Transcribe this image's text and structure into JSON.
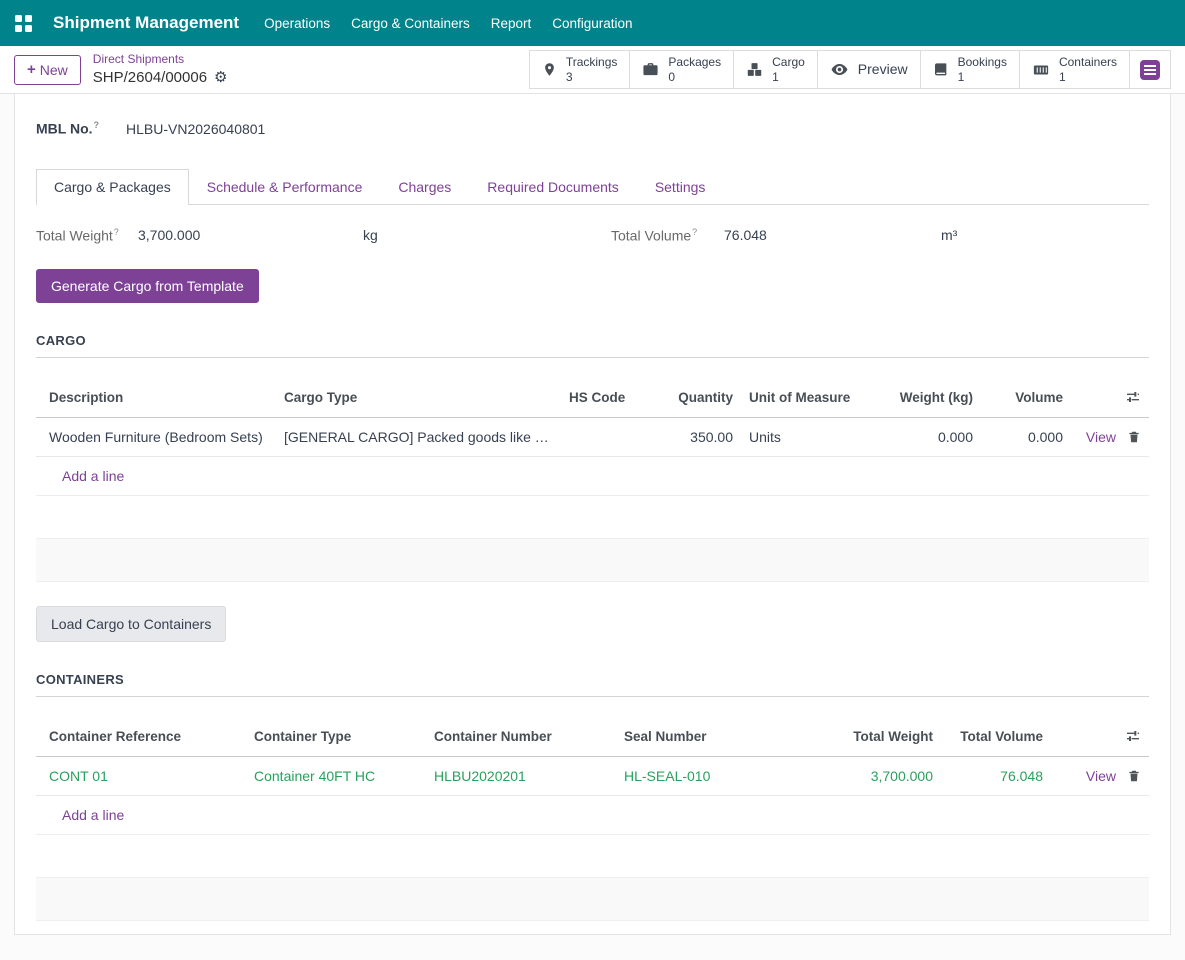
{
  "colors": {
    "navbar": "#00838b",
    "accent": "#7d4296",
    "success": "#28a15d"
  },
  "navbar": {
    "app_title": "Shipment Management",
    "menus": [
      {
        "label": "Operations"
      },
      {
        "label": "Cargo & Containers"
      },
      {
        "label": "Report"
      },
      {
        "label": "Configuration"
      }
    ]
  },
  "control_panel": {
    "new_button": "New",
    "plus": "+",
    "breadcrumb_parent": "Direct Shipments",
    "breadcrumb_current": "SHP/2604/00006",
    "gear": "⚙"
  },
  "smart_buttons": [
    {
      "label": "Trackings",
      "count": "3",
      "icon": "map-marker-icon"
    },
    {
      "label": "Packages",
      "count": "0",
      "icon": "briefcase-icon"
    },
    {
      "label": "Cargo",
      "count": "1",
      "icon": "cargo-boxes-icon"
    },
    {
      "label": "Preview",
      "count": "",
      "icon": "eye-icon"
    },
    {
      "label": "Bookings",
      "count": "1",
      "icon": "book-icon"
    },
    {
      "label": "Containers",
      "count": "1",
      "icon": "container-icon"
    }
  ],
  "form": {
    "mbl": {
      "label": "MBL No.",
      "help": "?",
      "value": "HLBU-VN2026040801"
    },
    "tabs": [
      {
        "label": "Cargo & Packages"
      },
      {
        "label": "Schedule & Performance"
      },
      {
        "label": "Charges"
      },
      {
        "label": "Required Documents"
      },
      {
        "label": "Settings"
      }
    ],
    "total_weight": {
      "label": "Total Weight",
      "help": "?",
      "value": "3,700.000",
      "uom": "kg"
    },
    "total_volume": {
      "label": "Total Volume",
      "help": "?",
      "value": "76.048",
      "uom": "m³"
    },
    "generate_button": "Generate Cargo from Template",
    "cargo_section": {
      "title": "CARGO",
      "columns": [
        "Description",
        "Cargo Type",
        "HS Code",
        "Quantity",
        "Unit of Measure",
        "Weight (kg)",
        "Volume"
      ],
      "rows": [
        {
          "description": "Wooden Furniture (Bedroom Sets)",
          "cargo_type": "[GENERAL CARGO] Packed goods like …",
          "hs_code": "",
          "quantity": "350.00",
          "uom": "Units",
          "weight": "0.000",
          "volume": "0.000",
          "view": "View"
        }
      ],
      "add_line": "Add a line"
    },
    "load_button": "Load Cargo to Containers",
    "containers_section": {
      "title": "CONTAINERS",
      "columns": [
        "Container Reference",
        "Container Type",
        "Container Number",
        "Seal Number",
        "Total Weight",
        "Total Volume"
      ],
      "rows": [
        {
          "reference": "CONT 01",
          "type": "Container 40FT HC",
          "number": "HLBU2020201",
          "seal": "HL-SEAL-010",
          "weight": "3,700.000",
          "volume": "76.048",
          "view": "View"
        }
      ],
      "add_line": "Add a line"
    }
  }
}
